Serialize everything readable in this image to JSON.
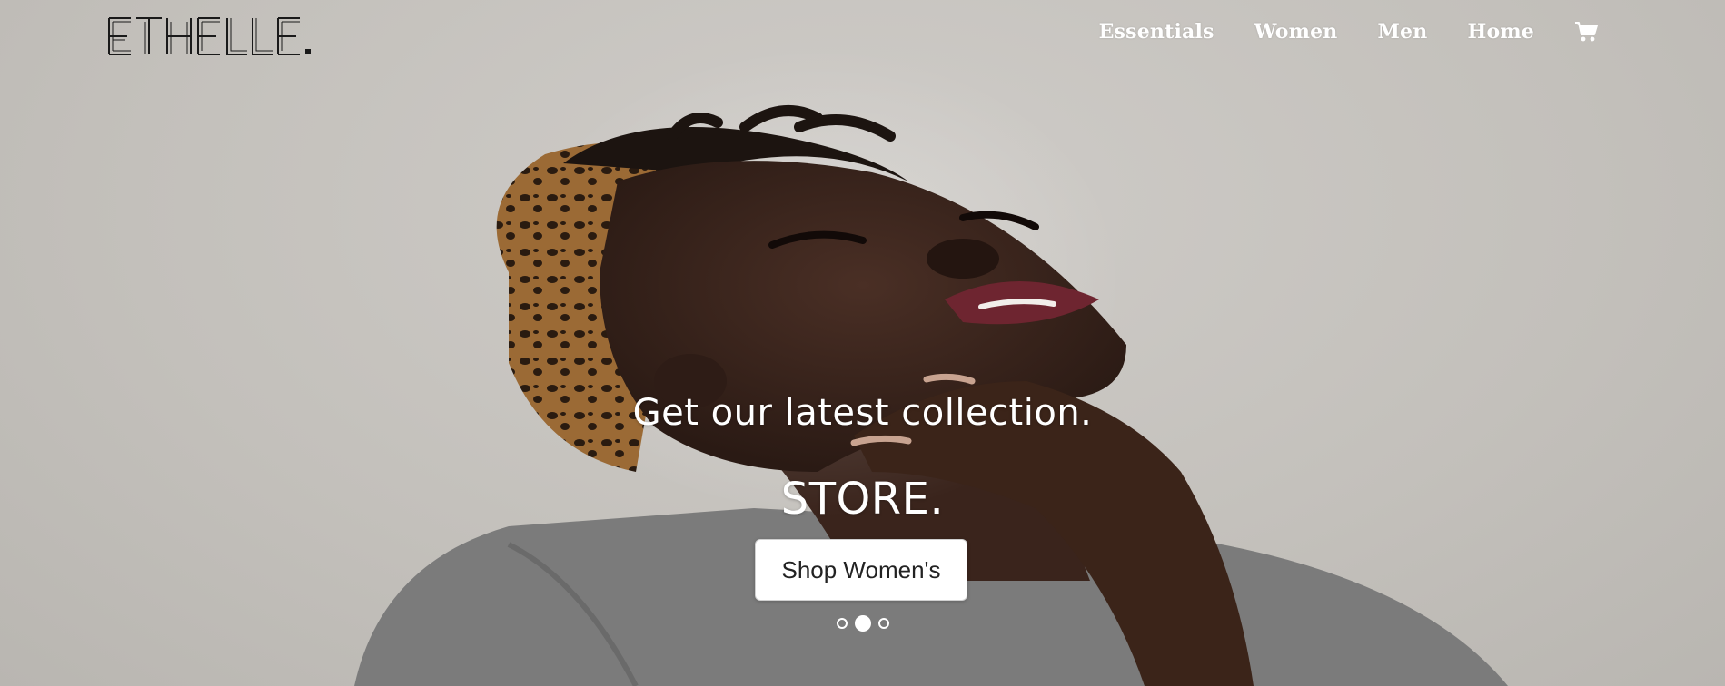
{
  "brand": {
    "logo_text": "ETHELLE."
  },
  "nav": {
    "items": [
      {
        "label": "Essentials"
      },
      {
        "label": "Women"
      },
      {
        "label": "Men"
      },
      {
        "label": "Home"
      }
    ],
    "cart_icon": "shopping-cart-icon"
  },
  "hero": {
    "headline": "Get our latest collection.",
    "subheadline": "STORE.",
    "cta_label": "Shop Women's",
    "slides_total": 3,
    "active_slide": 2
  },
  "colors": {
    "text": "#ffffff",
    "background": "#c8c5c1",
    "button_bg": "#ffffff",
    "button_text": "#222222"
  }
}
